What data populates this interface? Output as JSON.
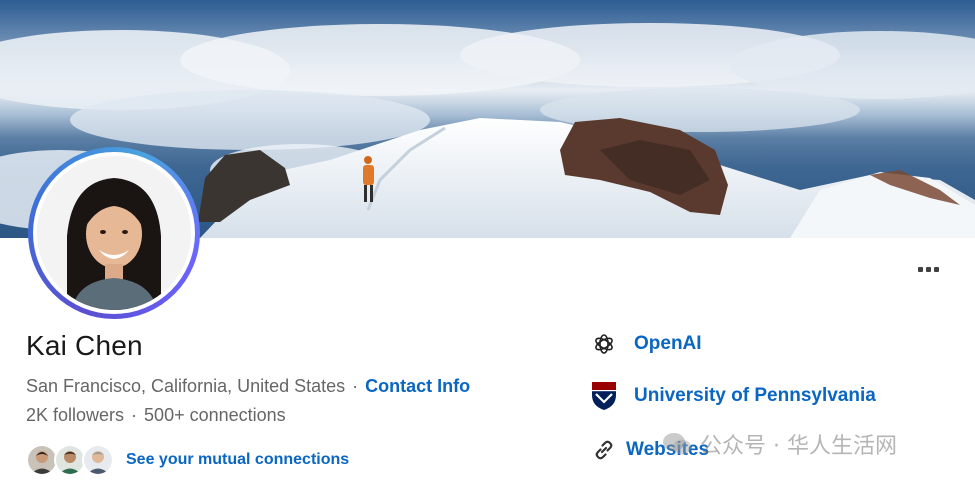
{
  "profile": {
    "name": "Kai Chen",
    "location": "San Francisco, California, United States",
    "separator": "·",
    "contact_info_label": "Contact Info",
    "followers": "2K followers",
    "connections": "500+ connections",
    "mutual_connections_label": "See your mutual connections"
  },
  "sidebar": {
    "company": "OpenAI",
    "education": "University of Pennsylvania",
    "websites_label": "Websites"
  },
  "watermark": {
    "text": "公众号 · 华人生活网"
  },
  "icons": {
    "more": "more-horizontal-icon",
    "company": "openai-logo-icon",
    "education": "upenn-shield-icon",
    "link": "link-icon"
  },
  "colors": {
    "link_blue": "#0a66c2",
    "text_secondary": "#666666",
    "text_primary": "#191919"
  }
}
